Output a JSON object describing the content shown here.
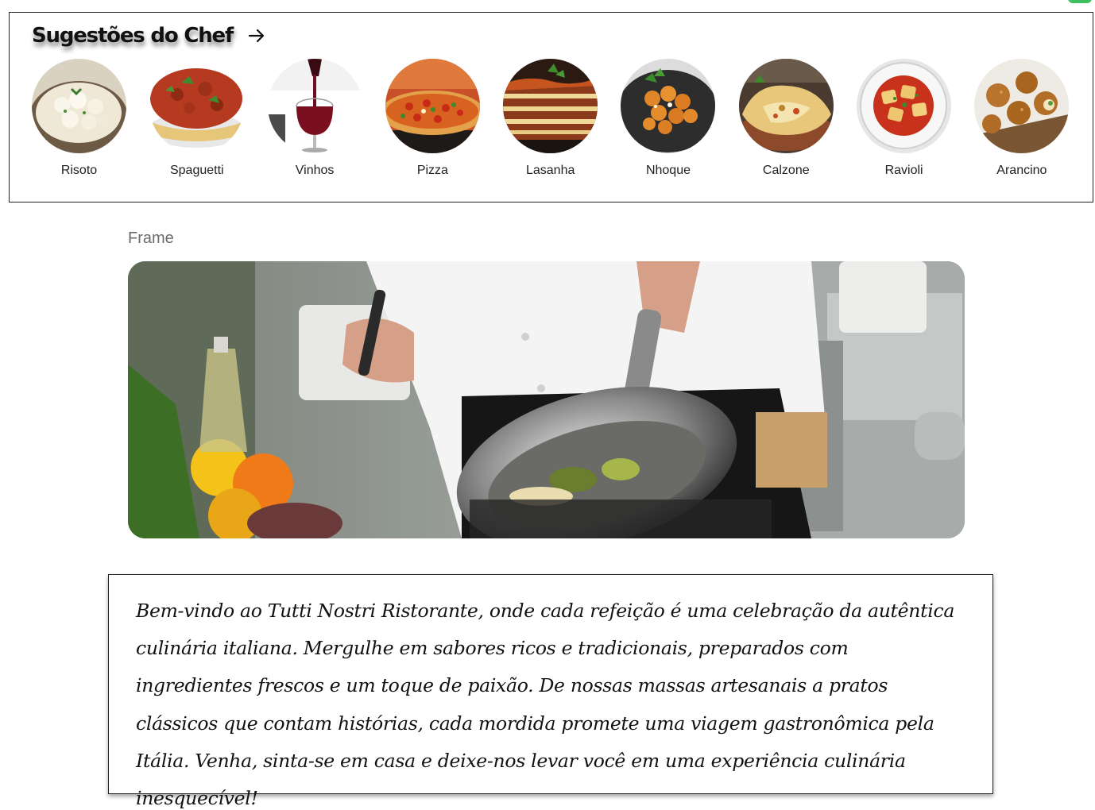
{
  "chef_section": {
    "title": "Sugestões do Chef",
    "arrow_icon": "arrow-right-icon",
    "dishes": [
      {
        "label": "Risoto",
        "icon": "risotto-photo"
      },
      {
        "label": "Spaguetti",
        "icon": "spaghetti-photo"
      },
      {
        "label": "Vinhos",
        "icon": "wine-photo"
      },
      {
        "label": "Pizza",
        "icon": "pizza-photo"
      },
      {
        "label": "Lasanha",
        "icon": "lasagna-photo"
      },
      {
        "label": "Nhoque",
        "icon": "gnocchi-photo"
      },
      {
        "label": "Calzone",
        "icon": "calzone-photo"
      },
      {
        "label": "Ravioli",
        "icon": "ravioli-photo"
      },
      {
        "label": "Arancino",
        "icon": "arancino-photo"
      }
    ]
  },
  "frame": {
    "label": "Frame",
    "image_icon": "chef-cooking-photo"
  },
  "welcome": {
    "text": "Bem-vindo ao Tutti Nostri Ristorante, onde cada refeição é uma celebração da autêntica culinária italiana. Mergulhe em sabores ricos e tradicionais, preparados com ingredientes frescos e um toque de paixão. De nossas massas artesanais a pratos clássicos que contam histórias, cada mordida promete uma viagem gastronômica pela Itália. Venha, sinta-se em casa e deixe-nos levar você em uma experiência culinária inesquecível!"
  },
  "colors": {
    "border": "#222222",
    "frame_label": "#6b6b6b",
    "badge": "#3fbf5f"
  }
}
